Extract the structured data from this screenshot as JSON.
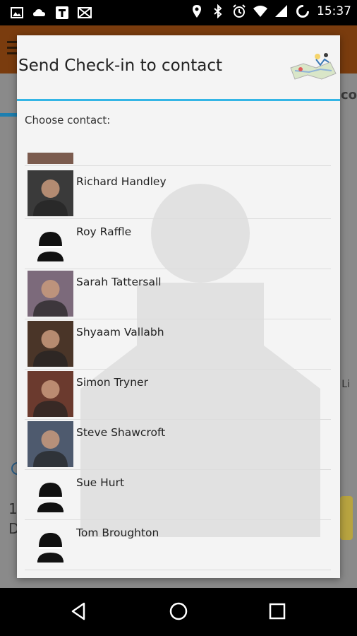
{
  "status_bar": {
    "time": "15:37",
    "left_icons": [
      "image-icon",
      "cloud-icon",
      "t-app-icon",
      "crossed-flags-icon"
    ],
    "right_icons": [
      "location-icon",
      "bluetooth-icon",
      "alarm-icon",
      "wifi-icon",
      "signal-icon",
      "sync-icon"
    ]
  },
  "background": {
    "tab_text": "co",
    "side_text": "Li",
    "left_text_1": "1",
    "left_text_2": "D"
  },
  "dialog": {
    "title": "Send Check-in to contact",
    "choose_label": "Choose contact:",
    "contacts": [
      {
        "name": "Richard Handley",
        "avatar": "photo",
        "color": "#3a3a3a"
      },
      {
        "name": "Roy Raffle",
        "avatar": "default"
      },
      {
        "name": "Sarah Tattersall",
        "avatar": "photo",
        "color": "#7c6a7b"
      },
      {
        "name": "Shyaam Vallabh",
        "avatar": "photo",
        "color": "#4a3528"
      },
      {
        "name": "Simon Tryner",
        "avatar": "photo",
        "color": "#6b3a2e"
      },
      {
        "name": "Steve Shawcroft",
        "avatar": "photo",
        "color": "#4e5a6e"
      },
      {
        "name": "Sue Hurt",
        "avatar": "default"
      },
      {
        "name": "Tom Broughton",
        "avatar": "default"
      }
    ]
  },
  "nav_bar": {
    "icons": [
      "back-icon",
      "home-icon",
      "recents-icon"
    ]
  }
}
